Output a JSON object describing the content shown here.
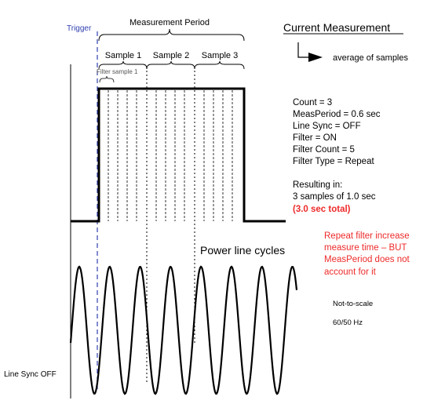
{
  "title": "Current Measurement",
  "arrow_note": "average of samples",
  "labels": {
    "trigger": "Trigger",
    "measurement_period": "Measurement Period",
    "filter_sample": "Filter sample 1",
    "samples": [
      "Sample 1",
      "Sample 2",
      "Sample 3"
    ],
    "power_line_cycles": "Power line cycles",
    "line_sync": "Line Sync OFF",
    "not_to_scale": "Not-to-scale",
    "frequency": "60/50 Hz"
  },
  "settings": [
    "Count = 3",
    "MeasPeriod = 0.6 sec",
    "Line Sync = OFF",
    "Filter = ON",
    "Filter Count = 5",
    "Filter Type = Repeat"
  ],
  "result": {
    "heading": "Resulting in:",
    "line": "3 samples of 1.0 sec",
    "total": "(3.0 sec total)"
  },
  "warning": [
    "Repeat filter increase",
    "measure time – BUT",
    "MeasPeriod does not",
    "account for it"
  ],
  "colors": {
    "trigger": "#2e3fb0",
    "alert": "#ee2a2a",
    "line": "#000000"
  }
}
